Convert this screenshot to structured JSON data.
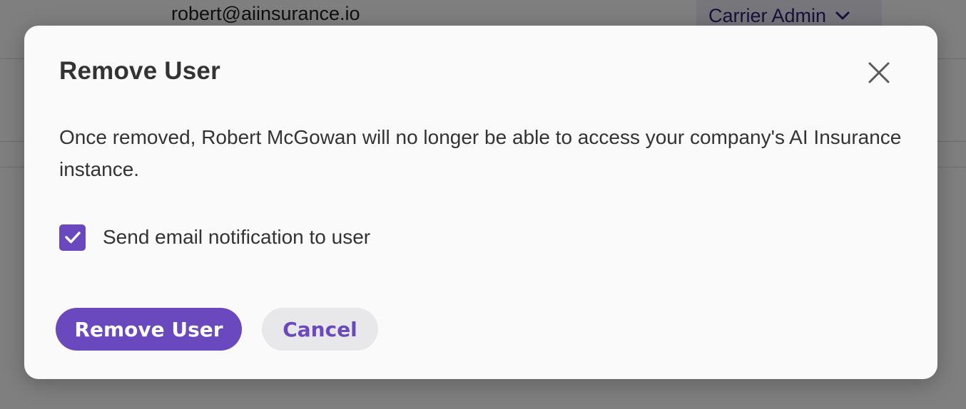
{
  "background": {
    "user_email": "robert@aiinsurance.io",
    "user_role": "Carrier Admin",
    "role_dropdown_icon": "chevron-down-icon"
  },
  "modal": {
    "title": "Remove User",
    "close_icon": "close-icon",
    "message": "Once removed, Robert McGowan will no longer be able to access your company's AI Insurance instance.",
    "checkbox": {
      "label": "Send email notification to user",
      "checked": true,
      "icon": "checkmark-icon"
    },
    "buttons": {
      "primary_label": "Remove User",
      "secondary_label": "Cancel"
    }
  },
  "colors": {
    "accent": "#6a48bd",
    "text": "#333333",
    "secondary_button_bg": "#e8e8eb",
    "modal_bg": "#fafafa"
  }
}
